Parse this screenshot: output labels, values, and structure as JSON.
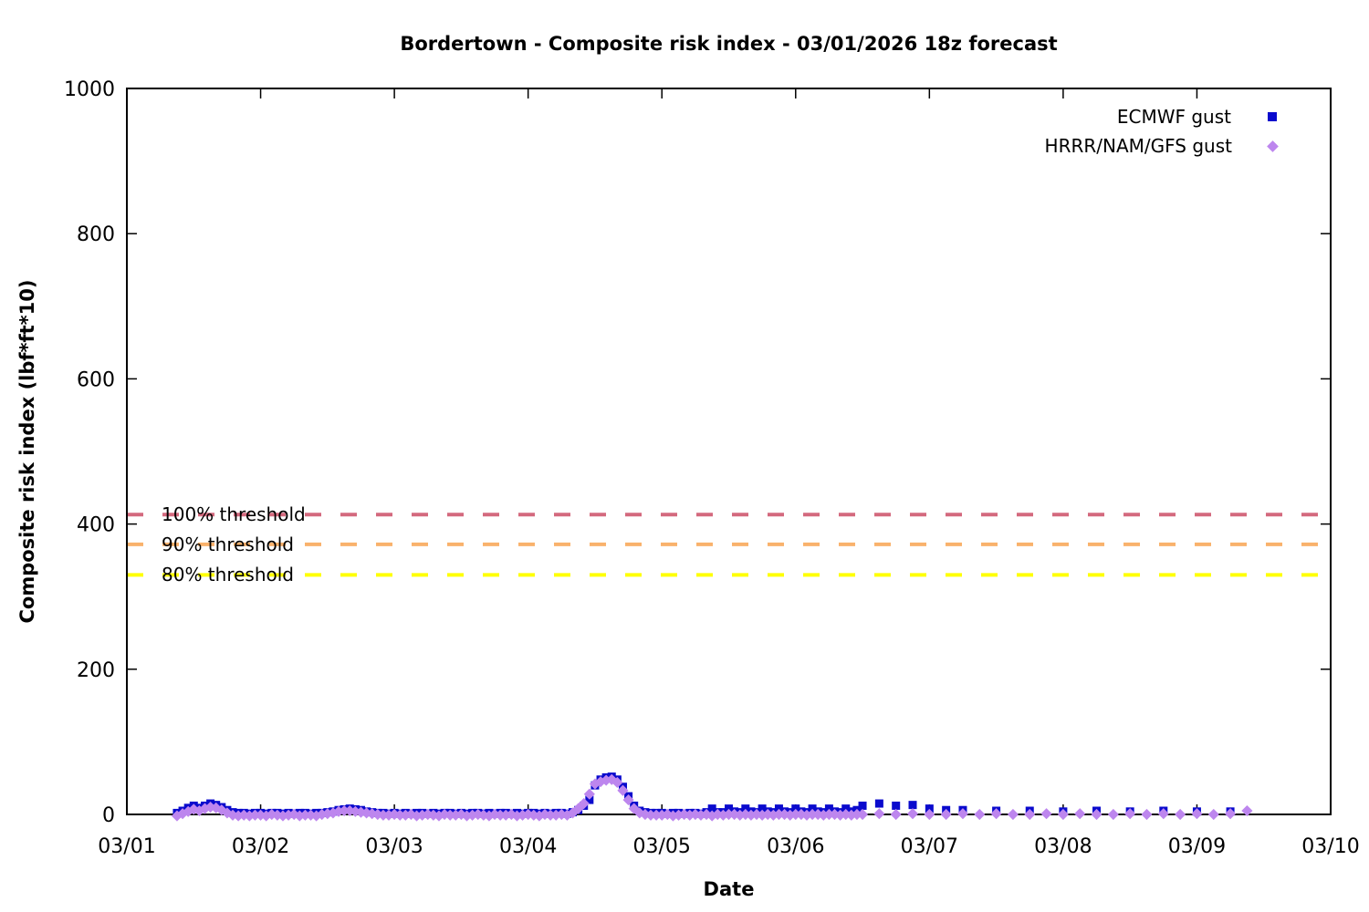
{
  "chart_data": {
    "type": "scatter",
    "title": "Bordertown - Composite risk index - 03/01/2026 18z forecast",
    "xlabel": "Date",
    "ylabel": "Composite risk index (lbf*ft*10)",
    "xlim": [
      0,
      9
    ],
    "ylim": [
      0,
      1000
    ],
    "grid": false,
    "legend_position": "top-right",
    "x_tick_labels": [
      "03/01",
      "03/02",
      "03/03",
      "03/04",
      "03/05",
      "03/06",
      "03/07",
      "03/08",
      "03/09",
      "03/10"
    ],
    "y_ticks": [
      0,
      200,
      400,
      600,
      800,
      1000
    ],
    "x_unit": "days since 03/01 (point x stored as hours since 03/01 00z)",
    "thresholds": [
      {
        "label": "100% threshold",
        "value": 413,
        "color": "#d4697e",
        "style": "dashed"
      },
      {
        "label": "90% threshold",
        "value": 372,
        "color": "#f9b26c",
        "style": "dashed"
      },
      {
        "label": "80% threshold",
        "value": 330,
        "color": "#ffff00",
        "style": "dashed"
      }
    ],
    "series": [
      {
        "name": "ECMWF gust",
        "marker": "square",
        "color": "#0a0acd",
        "points": [
          [
            9,
            2
          ],
          [
            10,
            5
          ],
          [
            11,
            9
          ],
          [
            12,
            12
          ],
          [
            13,
            9
          ],
          [
            14,
            12
          ],
          [
            15,
            15
          ],
          [
            16,
            13
          ],
          [
            17,
            10
          ],
          [
            18,
            6
          ],
          [
            19,
            3
          ],
          [
            20,
            2
          ],
          [
            21,
            2
          ],
          [
            22,
            1
          ],
          [
            23,
            2
          ],
          [
            24,
            2
          ],
          [
            25,
            1
          ],
          [
            26,
            2
          ],
          [
            27,
            2
          ],
          [
            28,
            1
          ],
          [
            29,
            2
          ],
          [
            30,
            1
          ],
          [
            31,
            2
          ],
          [
            32,
            2
          ],
          [
            33,
            1
          ],
          [
            34,
            2
          ],
          [
            35,
            2
          ],
          [
            36,
            3
          ],
          [
            37,
            4
          ],
          [
            38,
            6
          ],
          [
            39,
            7
          ],
          [
            40,
            8
          ],
          [
            41,
            7
          ],
          [
            42,
            6
          ],
          [
            43,
            4
          ],
          [
            44,
            3
          ],
          [
            45,
            2
          ],
          [
            46,
            2
          ],
          [
            47,
            1
          ],
          [
            48,
            2
          ],
          [
            49,
            1
          ],
          [
            50,
            2
          ],
          [
            51,
            1
          ],
          [
            52,
            2
          ],
          [
            53,
            2
          ],
          [
            54,
            1
          ],
          [
            55,
            2
          ],
          [
            56,
            1
          ],
          [
            57,
            2
          ],
          [
            58,
            2
          ],
          [
            59,
            1
          ],
          [
            60,
            2
          ],
          [
            61,
            1
          ],
          [
            62,
            2
          ],
          [
            63,
            2
          ],
          [
            64,
            1
          ],
          [
            65,
            2
          ],
          [
            66,
            1
          ],
          [
            67,
            2
          ],
          [
            68,
            2
          ],
          [
            69,
            1
          ],
          [
            70,
            2
          ],
          [
            71,
            1
          ],
          [
            72,
            2
          ],
          [
            73,
            2
          ],
          [
            74,
            1
          ],
          [
            75,
            2
          ],
          [
            76,
            1
          ],
          [
            77,
            2
          ],
          [
            78,
            2
          ],
          [
            79,
            1
          ],
          [
            80,
            3
          ],
          [
            81,
            6
          ],
          [
            82,
            12
          ],
          [
            83,
            20
          ],
          [
            84,
            40
          ],
          [
            85,
            48
          ],
          [
            86,
            51
          ],
          [
            87,
            52
          ],
          [
            88,
            48
          ],
          [
            89,
            38
          ],
          [
            90,
            25
          ],
          [
            91,
            12
          ],
          [
            92,
            5
          ],
          [
            93,
            3
          ],
          [
            94,
            2
          ],
          [
            95,
            2
          ],
          [
            96,
            2
          ],
          [
            97,
            1
          ],
          [
            98,
            2
          ],
          [
            99,
            2
          ],
          [
            100,
            1
          ],
          [
            101,
            2
          ],
          [
            102,
            2
          ],
          [
            103,
            1
          ],
          [
            104,
            3
          ],
          [
            105,
            8
          ],
          [
            106,
            3
          ],
          [
            107,
            3
          ],
          [
            108,
            8
          ],
          [
            109,
            4
          ],
          [
            110,
            3
          ],
          [
            111,
            8
          ],
          [
            112,
            4
          ],
          [
            113,
            3
          ],
          [
            114,
            8
          ],
          [
            115,
            4
          ],
          [
            116,
            3
          ],
          [
            117,
            8
          ],
          [
            118,
            4
          ],
          [
            119,
            3
          ],
          [
            120,
            8
          ],
          [
            121,
            4
          ],
          [
            122,
            3
          ],
          [
            123,
            8
          ],
          [
            124,
            4
          ],
          [
            125,
            3
          ],
          [
            126,
            8
          ],
          [
            127,
            4
          ],
          [
            128,
            3
          ],
          [
            129,
            8
          ],
          [
            130,
            4
          ],
          [
            131,
            6
          ],
          [
            132,
            12
          ],
          [
            135,
            15
          ],
          [
            138,
            12
          ],
          [
            141,
            13
          ],
          [
            144,
            8
          ],
          [
            147,
            6
          ],
          [
            150,
            6
          ],
          [
            156,
            5
          ],
          [
            162,
            5
          ],
          [
            168,
            4
          ],
          [
            174,
            5
          ],
          [
            180,
            4
          ],
          [
            186,
            5
          ],
          [
            192,
            4
          ],
          [
            198,
            4
          ]
        ]
      },
      {
        "name": "HRRR/NAM/GFS gust",
        "marker": "diamond",
        "color": "#bd86ee",
        "points": [
          [
            9,
            -2
          ],
          [
            10,
            1
          ],
          [
            11,
            4
          ],
          [
            12,
            7
          ],
          [
            13,
            5
          ],
          [
            14,
            8
          ],
          [
            15,
            10
          ],
          [
            16,
            9
          ],
          [
            17,
            6
          ],
          [
            18,
            2
          ],
          [
            19,
            -1
          ],
          [
            20,
            -2
          ],
          [
            21,
            -1
          ],
          [
            22,
            -2
          ],
          [
            23,
            -1
          ],
          [
            24,
            -1
          ],
          [
            25,
            -2
          ],
          [
            26,
            0
          ],
          [
            27,
            -1
          ],
          [
            28,
            -2
          ],
          [
            29,
            -1
          ],
          [
            30,
            0
          ],
          [
            31,
            -2
          ],
          [
            32,
            -1
          ],
          [
            33,
            -1
          ],
          [
            34,
            -2
          ],
          [
            35,
            0
          ],
          [
            36,
            1
          ],
          [
            37,
            2
          ],
          [
            38,
            4
          ],
          [
            39,
            5
          ],
          [
            40,
            5
          ],
          [
            41,
            4
          ],
          [
            42,
            3
          ],
          [
            43,
            2
          ],
          [
            44,
            1
          ],
          [
            45,
            0
          ],
          [
            46,
            -1
          ],
          [
            47,
            -1
          ],
          [
            48,
            0
          ],
          [
            49,
            -1
          ],
          [
            50,
            -1
          ],
          [
            51,
            0
          ],
          [
            52,
            -2
          ],
          [
            53,
            -1
          ],
          [
            54,
            0
          ],
          [
            55,
            -1
          ],
          [
            56,
            -2
          ],
          [
            57,
            0
          ],
          [
            58,
            -1
          ],
          [
            59,
            -1
          ],
          [
            60,
            0
          ],
          [
            61,
            -2
          ],
          [
            62,
            -1
          ],
          [
            63,
            0
          ],
          [
            64,
            -1
          ],
          [
            65,
            -2
          ],
          [
            66,
            0
          ],
          [
            67,
            -1
          ],
          [
            68,
            -1
          ],
          [
            69,
            0
          ],
          [
            70,
            -2
          ],
          [
            71,
            -1
          ],
          [
            72,
            0
          ],
          [
            73,
            -1
          ],
          [
            74,
            -2
          ],
          [
            75,
            0
          ],
          [
            76,
            -1
          ],
          [
            77,
            -1
          ],
          [
            78,
            0
          ],
          [
            79,
            -1
          ],
          [
            80,
            2
          ],
          [
            81,
            8
          ],
          [
            82,
            15
          ],
          [
            83,
            28
          ],
          [
            84,
            42
          ],
          [
            85,
            45
          ],
          [
            86,
            47
          ],
          [
            87,
            48
          ],
          [
            88,
            44
          ],
          [
            89,
            33
          ],
          [
            90,
            20
          ],
          [
            91,
            8
          ],
          [
            92,
            2
          ],
          [
            93,
            0
          ],
          [
            94,
            -1
          ],
          [
            95,
            -1
          ],
          [
            96,
            -1
          ],
          [
            97,
            0
          ],
          [
            98,
            -2
          ],
          [
            99,
            -1
          ],
          [
            100,
            0
          ],
          [
            101,
            -1
          ],
          [
            102,
            0
          ],
          [
            103,
            -1
          ],
          [
            104,
            0
          ],
          [
            105,
            -2
          ],
          [
            106,
            0
          ],
          [
            107,
            -1
          ],
          [
            108,
            0
          ],
          [
            109,
            0
          ],
          [
            110,
            -1
          ],
          [
            111,
            0
          ],
          [
            112,
            -1
          ],
          [
            113,
            0
          ],
          [
            114,
            -1
          ],
          [
            115,
            0
          ],
          [
            116,
            -1
          ],
          [
            117,
            0
          ],
          [
            118,
            0
          ],
          [
            119,
            -1
          ],
          [
            120,
            0
          ],
          [
            121,
            0
          ],
          [
            122,
            -1
          ],
          [
            123,
            0
          ],
          [
            124,
            0
          ],
          [
            125,
            -1
          ],
          [
            126,
            0
          ],
          [
            127,
            0
          ],
          [
            128,
            -1
          ],
          [
            129,
            0
          ],
          [
            130,
            -1
          ],
          [
            131,
            0
          ],
          [
            132,
            0
          ],
          [
            135,
            1
          ],
          [
            138,
            0
          ],
          [
            141,
            1
          ],
          [
            144,
            0
          ],
          [
            147,
            0
          ],
          [
            150,
            1
          ],
          [
            153,
            0
          ],
          [
            156,
            1
          ],
          [
            159,
            0
          ],
          [
            162,
            0
          ],
          [
            165,
            1
          ],
          [
            168,
            0
          ],
          [
            171,
            1
          ],
          [
            174,
            0
          ],
          [
            177,
            0
          ],
          [
            180,
            1
          ],
          [
            183,
            0
          ],
          [
            186,
            1
          ],
          [
            189,
            0
          ],
          [
            192,
            1
          ],
          [
            195,
            0
          ],
          [
            198,
            1
          ],
          [
            201,
            5
          ]
        ]
      }
    ]
  }
}
